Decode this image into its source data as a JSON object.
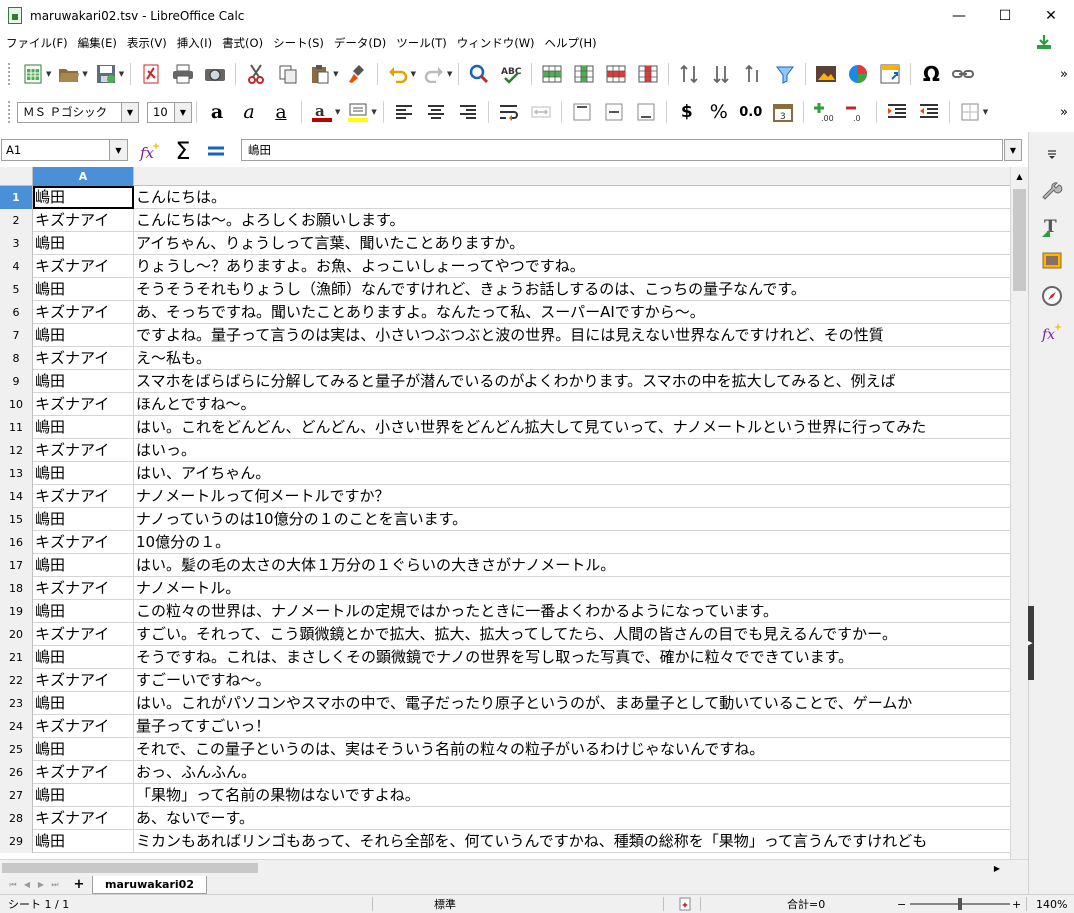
{
  "window": {
    "title": "maruwakari02.tsv - LibreOffice Calc",
    "minimize": "—",
    "maximize": "☐",
    "close": "✕"
  },
  "menu": [
    "ファイル(F)",
    "編集(E)",
    "表示(V)",
    "挿入(I)",
    "書式(O)",
    "シート(S)",
    "データ(D)",
    "ツール(T)",
    "ウィンドウ(W)",
    "ヘルプ(H)"
  ],
  "toolbar2": {
    "font_name": "ＭＳ Ｐゴシック",
    "font_size": "10",
    "currency": "$",
    "percent": "%",
    "decimal": "0.0"
  },
  "formula_bar": {
    "name_box": "A1",
    "content": "嶋田"
  },
  "grid": {
    "column_a": "A",
    "rows": [
      {
        "n": "1",
        "a": "嶋田",
        "b": "こんにちは。"
      },
      {
        "n": "2",
        "a": "キズナアイ",
        "b": "こんにちは～。よろしくお願いします。"
      },
      {
        "n": "3",
        "a": "嶋田",
        "b": "アイちゃん、りょうしって言葉、聞いたことありますか。"
      },
      {
        "n": "4",
        "a": "キズナアイ",
        "b": "りょうし～？ありますよ。お魚、よっこいしょーってやつですね。"
      },
      {
        "n": "5",
        "a": "嶋田",
        "b": "そうそうそれもりょうし（漁師）なんですけれど、きょうお話しするのは、こっちの量子なんです。"
      },
      {
        "n": "6",
        "a": "キズナアイ",
        "b": "あ、そっちですね。聞いたことありますよ。なんたって私、スーパーAIですから～。"
      },
      {
        "n": "7",
        "a": "嶋田",
        "b": "ですよね。量子って言うのは実は、小さいつぶつぶと波の世界。目には見えない世界なんですけれど、その性質"
      },
      {
        "n": "8",
        "a": "キズナアイ",
        "b": "え～私も。"
      },
      {
        "n": "9",
        "a": "嶋田",
        "b": "スマホをばらばらに分解してみると量子が潜んでいるのがよくわかります。スマホの中を拡大してみると、例えば"
      },
      {
        "n": "10",
        "a": "キズナアイ",
        "b": "ほんとですね～。"
      },
      {
        "n": "11",
        "a": "嶋田",
        "b": "はい。これをどんどん、どんどん、小さい世界をどんどん拡大して見ていって、ナノメートルという世界に行ってみた"
      },
      {
        "n": "12",
        "a": "キズナアイ",
        "b": "はいっ。"
      },
      {
        "n": "13",
        "a": "嶋田",
        "b": "はい、アイちゃん。"
      },
      {
        "n": "14",
        "a": "キズナアイ",
        "b": "ナノメートルって何メートルですか？"
      },
      {
        "n": "15",
        "a": "嶋田",
        "b": "ナノっていうのは10億分の１のことを言います。"
      },
      {
        "n": "16",
        "a": "キズナアイ",
        "b": "10億分の１。"
      },
      {
        "n": "17",
        "a": "嶋田",
        "b": "はい。髪の毛の太さの大体１万分の１ぐらいの大きさがナノメートル。"
      },
      {
        "n": "18",
        "a": "キズナアイ",
        "b": "ナノメートル。"
      },
      {
        "n": "19",
        "a": "嶋田",
        "b": "この粒々の世界は、ナノメートルの定規ではかったときに一番よくわかるようになっています。"
      },
      {
        "n": "20",
        "a": "キズナアイ",
        "b": "すごい。それって、こう顕微鏡とかで拡大、拡大、拡大ってしてたら、人間の皆さんの目でも見えるんですかー。"
      },
      {
        "n": "21",
        "a": "嶋田",
        "b": "そうですね。これは、まさしくその顕微鏡でナノの世界を写し取った写真で、確かに粒々でできています。"
      },
      {
        "n": "22",
        "a": "キズナアイ",
        "b": "すごーいですね～。"
      },
      {
        "n": "23",
        "a": "嶋田",
        "b": "はい。これがパソコンやスマホの中で、電子だったり原子というのが、まあ量子として動いていることで、ゲームか"
      },
      {
        "n": "24",
        "a": "キズナアイ",
        "b": "量子ってすごいっ！"
      },
      {
        "n": "25",
        "a": "嶋田",
        "b": "それで、この量子というのは、実はそういう名前の粒々の粒子がいるわけじゃないんですね。"
      },
      {
        "n": "26",
        "a": "キズナアイ",
        "b": "おっ、ふんふん。"
      },
      {
        "n": "27",
        "a": "嶋田",
        "b": "「果物」って名前の果物はないですよね。"
      },
      {
        "n": "28",
        "a": "キズナアイ",
        "b": "あ、ないでーす。"
      },
      {
        "n": "29",
        "a": "嶋田",
        "b": "ミカンもあればリンゴもあって、それら全部を、何ていうんですかね、種類の総称を「果物」って言うんですけれども"
      }
    ]
  },
  "sheet_tab": "maruwakari02",
  "status": {
    "sheet": "シート 1 / 1",
    "style": "標準",
    "sum": "合計=0",
    "zoom_minus": "−",
    "zoom_plus": "+",
    "zoom": "140%"
  },
  "colors": {
    "accent": "#4a90d9",
    "header_bg": "#f0f0f0"
  }
}
